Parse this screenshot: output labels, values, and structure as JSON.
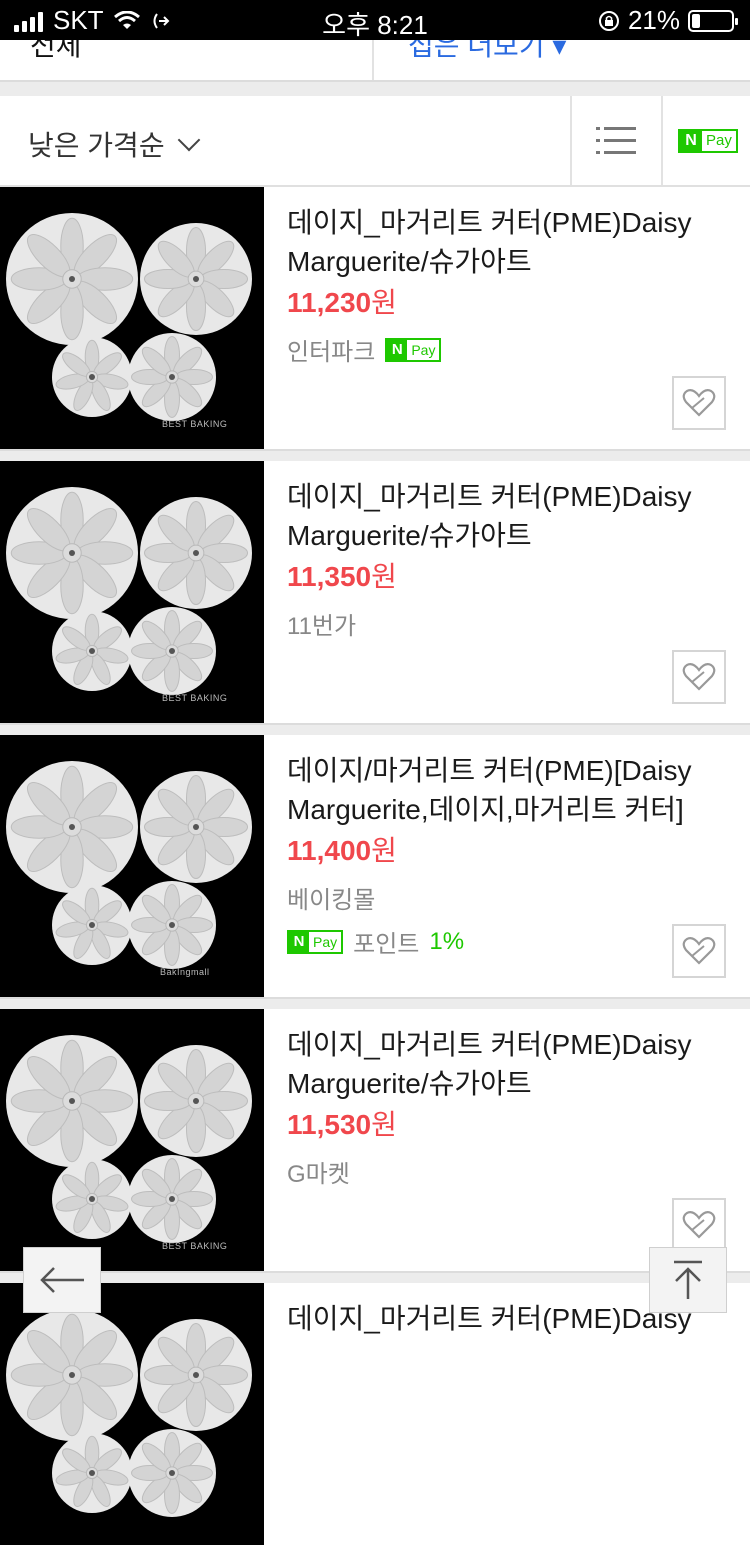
{
  "status_bar": {
    "carrier": "SKT",
    "time": "오후 8:21",
    "battery": "21%",
    "battery_level": 0.21
  },
  "top_strip": {
    "left_text": "전체",
    "right_text": "접은 더보기 ▾"
  },
  "sort": {
    "label": "낮은 가격순",
    "npay_n": "N",
    "npay_text": "Pay"
  },
  "items": [
    {
      "title": "데이지_마거리트 커터(PME)Daisy Marguerite/슈가아트",
      "price": "11,230",
      "won": "원",
      "seller": "인터파크",
      "npay": true,
      "point_label": "",
      "point_pct": ""
    },
    {
      "title": "데이지_마거리트 커터(PME)Daisy Marguerite/슈가아트",
      "price": "11,350",
      "won": "원",
      "seller": "11번가",
      "npay": false,
      "point_label": "",
      "point_pct": ""
    },
    {
      "title": "데이지/마거리트 커터(PME)[Daisy Marguerite,데이지,마거리트 커터]",
      "price": "11,400",
      "won": "원",
      "seller": "베이킹몰",
      "npay": false,
      "point_label": "포인트",
      "point_pct": "1%"
    },
    {
      "title": "데이지_마거리트 커터(PME)Daisy Marguerite/슈가아트",
      "price": "11,530",
      "won": "원",
      "seller": "G마켓",
      "npay": false,
      "point_label": "",
      "point_pct": ""
    },
    {
      "title": "데이지_마거리트 커터(PME)Daisy",
      "price": "",
      "won": "",
      "seller": "",
      "npay": false,
      "point_label": "",
      "point_pct": ""
    }
  ],
  "npay_badge": {
    "n": "N",
    "text": "Pay"
  },
  "watermarks": [
    "BEST BAKING",
    "BEST BAKING",
    "BakIngmall",
    "BEST BAKING"
  ],
  "icons": {
    "back": "arrow-left-icon",
    "top": "arrow-up-icon",
    "wish": "heart-icon",
    "list": "list-view-icon"
  }
}
